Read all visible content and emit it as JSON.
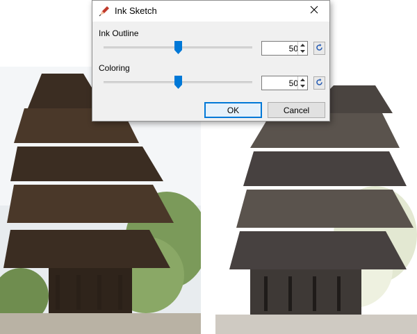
{
  "dialog": {
    "title": "Ink Sketch",
    "icons": {
      "app": "ink-sketch-icon",
      "close": "close-icon"
    },
    "ink_outline": {
      "label": "Ink Outline",
      "value": "50",
      "slider_fraction": 0.5
    },
    "coloring": {
      "label": "Coloring",
      "value": "50",
      "slider_fraction": 0.5
    },
    "ok_label": "OK",
    "cancel_label": "Cancel"
  },
  "colors": {
    "accent": "#0078d7",
    "dialog_bg": "#f0f0f0",
    "reset_icon": "#2b5fb4"
  }
}
